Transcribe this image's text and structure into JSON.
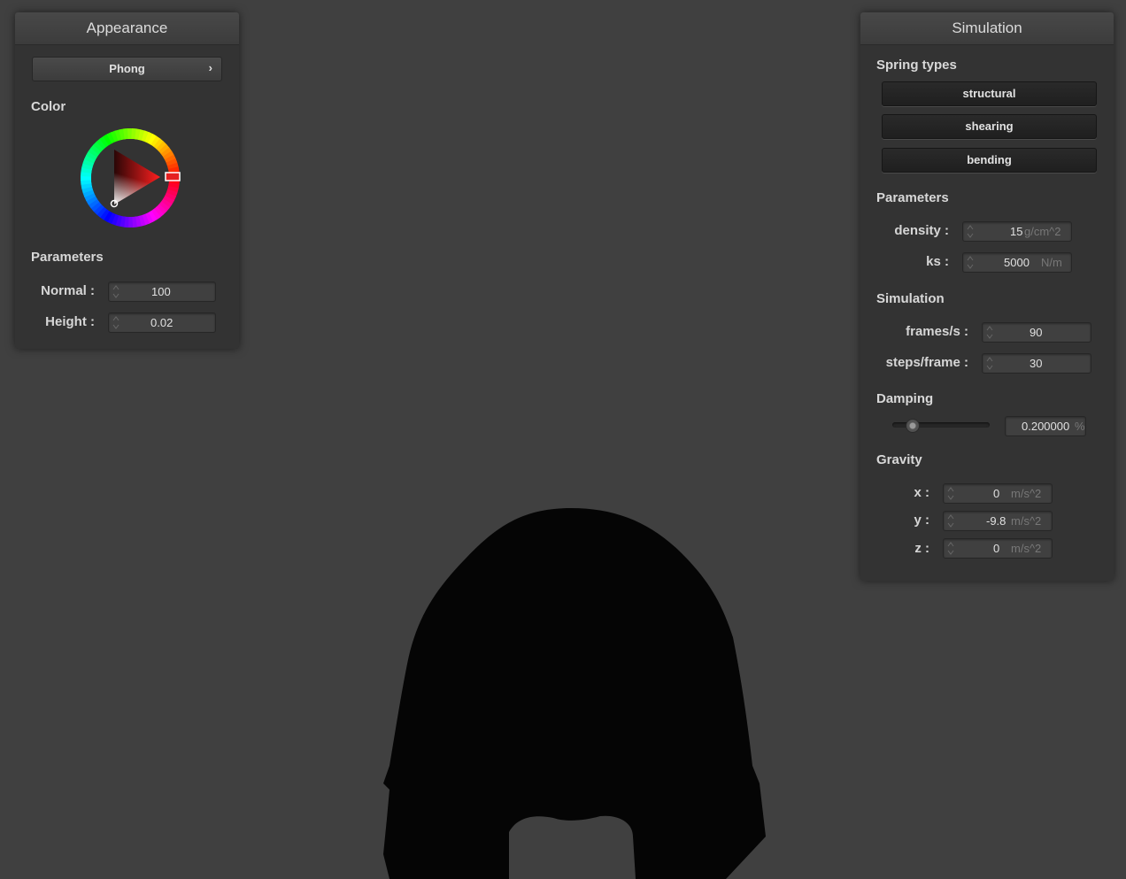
{
  "appearance": {
    "title": "Appearance",
    "shader_selected": "Phong",
    "shader_arrow": "›",
    "color_label": "Color",
    "color_hue": "#ff0000",
    "params_label": "Parameters",
    "normal": {
      "label": "Normal :",
      "value": "100"
    },
    "height": {
      "label": "Height :",
      "value": "0.02"
    }
  },
  "simulation": {
    "title": "Simulation",
    "spring_types_label": "Spring types",
    "spring_buttons": [
      "structural",
      "shearing",
      "bending"
    ],
    "parameters_label": "Parameters",
    "density": {
      "label": "density :",
      "value": "15",
      "unit": "g/cm^2"
    },
    "ks": {
      "label": "ks :",
      "value": "5000",
      "unit": "N/m"
    },
    "sim_label": "Simulation",
    "frames": {
      "label": "frames/s :",
      "value": "90"
    },
    "steps": {
      "label": "steps/frame :",
      "value": "30"
    },
    "damping_label": "Damping",
    "damping": {
      "value": "0.200000",
      "unit": "%",
      "slider_fraction": 0.2
    },
    "gravity_label": "Gravity",
    "gravity": [
      {
        "label": "x :",
        "value": "0",
        "unit": "m/s^2"
      },
      {
        "label": "y :",
        "value": "-9.8",
        "unit": "m/s^2"
      },
      {
        "label": "z :",
        "value": "0",
        "unit": "m/s^2"
      }
    ]
  },
  "colors": {
    "background": "#404040",
    "panel": "#333333",
    "cloth": "#050505"
  }
}
